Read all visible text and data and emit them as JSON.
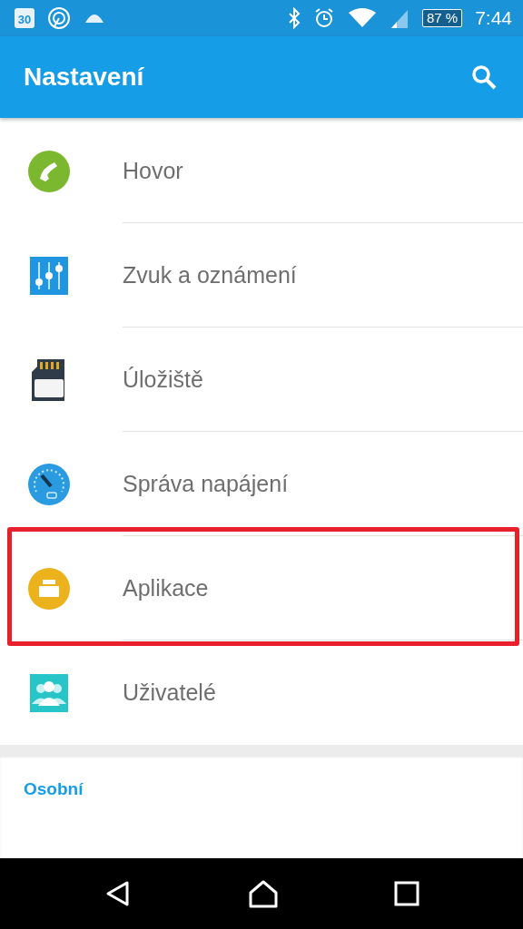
{
  "status_bar": {
    "calendar_day": "30",
    "battery": "87 %",
    "time": "7:44"
  },
  "app_bar": {
    "title": "Nastavení"
  },
  "items": [
    {
      "label": "Hovor",
      "kind": "call",
      "highlighted": false
    },
    {
      "label": "Zvuk a oznámení",
      "kind": "sound",
      "highlighted": false
    },
    {
      "label": "Úložiště",
      "kind": "storage",
      "highlighted": false
    },
    {
      "label": "Správa napájení",
      "kind": "power",
      "highlighted": false
    },
    {
      "label": "Aplikace",
      "kind": "apps",
      "highlighted": true
    },
    {
      "label": "Uživatelé",
      "kind": "users",
      "highlighted": false
    }
  ],
  "section": {
    "title": "Osobní"
  }
}
